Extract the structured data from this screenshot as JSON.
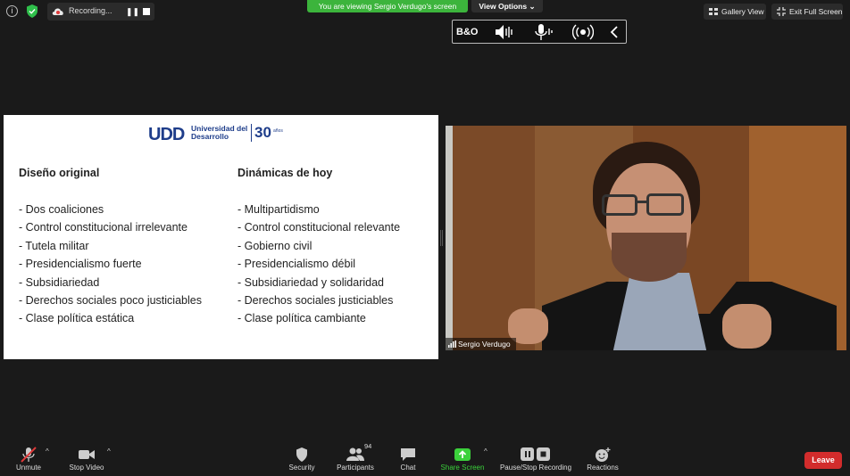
{
  "topbar": {
    "recording_label": "Recording...",
    "viewing_banner": "You are viewing Sergio Verdugo's screen",
    "view_options": "View Options",
    "view_options_caret": "⌄",
    "gallery_view": "Gallery View",
    "exit_full_screen": "Exit Full Screen"
  },
  "audio_toolbar": {
    "icons": [
      "bo-logo-icon",
      "speaker-icon",
      "microphone-icon",
      "broadcast-icon",
      "chevron-left-icon"
    ],
    "bo_label": "B&O"
  },
  "slide": {
    "logo_udd": "UDD",
    "logo_name": "Universidad del Desarrollo",
    "logo_30": "30",
    "logo_anos": "años",
    "left_title": "Diseño original",
    "left_items": [
      "- Dos coaliciones",
      "- Control constitucional irrelevante",
      "- Tutela militar",
      "- Presidencialismo fuerte",
      "- Subsidiariedad",
      "- Derechos sociales poco justiciables",
      "- Clase política estática"
    ],
    "right_title": "Dinámicas de hoy",
    "right_items": [
      "- Multipartidismo",
      "- Control constitucional relevante",
      "- Gobierno civil",
      "- Presidencialismo débil",
      "- Subsidiariedad y solidaridad",
      "- Derechos sociales justiciables",
      "- Clase política cambiante"
    ]
  },
  "video": {
    "participant_name": "Sergio Verdugo"
  },
  "bottombar": {
    "unmute": "Unmute",
    "stop_video": "Stop Video",
    "security": "Security",
    "participants": "Participants",
    "participants_count": "94",
    "chat": "Chat",
    "share_screen": "Share Screen",
    "pause_stop_recording": "Pause/Stop Recording",
    "reactions": "Reactions",
    "leave": "Leave",
    "caret": "^"
  },
  "colors": {
    "banner_green": "#3cb43c",
    "share_green": "#3bd13b",
    "leave_red": "#d22c2c",
    "udd_blue": "#1e3d8a"
  }
}
